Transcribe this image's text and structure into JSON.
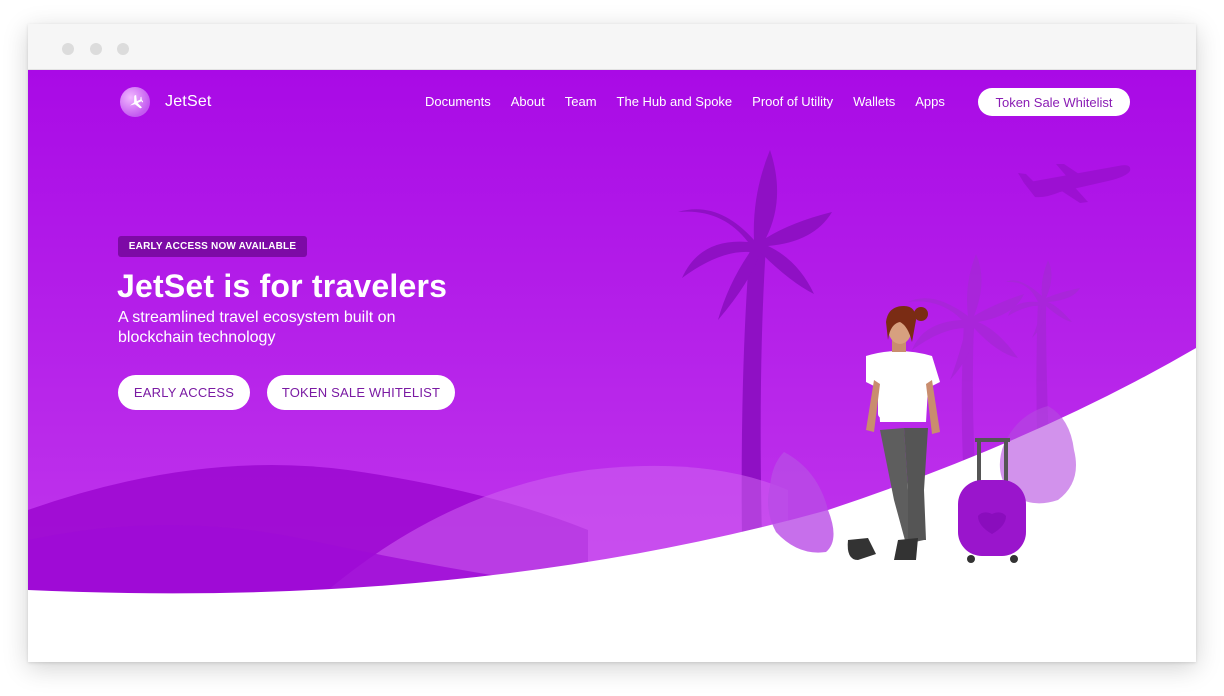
{
  "window": {
    "controls": [
      "close",
      "minimize",
      "maximize"
    ]
  },
  "nav": {
    "brand": "JetSet",
    "brand_icon": "airplane-icon",
    "links": [
      "Documents",
      "About",
      "Team",
      "The Hub and Spoke",
      "Proof of Utility",
      "Wallets",
      "Apps"
    ],
    "cta": "Token Sale Whitelist"
  },
  "hero": {
    "badge": "EARLY ACCESS NOW AVAILABLE",
    "title": "JetSet is for travelers",
    "subtitle": "A streamlined travel ecosystem built on blockchain technology",
    "primary_button": "EARLY ACCESS",
    "secondary_button": "TOKEN SALE WHITELIST"
  },
  "colors": {
    "hero_top": "#a505e0",
    "hero_bottom": "#c94ded",
    "accent_text": "#7a1aa3",
    "badge_bg": "#7d0aa6"
  }
}
